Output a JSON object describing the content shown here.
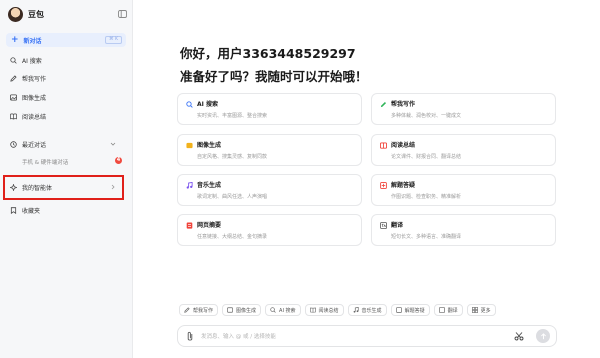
{
  "sidebar": {
    "brand_name": "豆包",
    "new_chat": {
      "label": "新对话",
      "shortcut": "⌘ K"
    },
    "items": [
      {
        "label": "AI 搜索",
        "icon": "search-icon"
      },
      {
        "label": "帮我写作",
        "icon": "pen-icon"
      },
      {
        "label": "图像生成",
        "icon": "image-icon"
      },
      {
        "label": "阅读总结",
        "icon": "book-icon"
      }
    ],
    "recent": {
      "label": "最近对话",
      "icon": "chat-icon"
    },
    "recent_sub": {
      "label": "手机 & 硬件端对话",
      "badge": "4"
    },
    "agents": {
      "label": "我的智能体",
      "icon": "sparkle-icon"
    },
    "favorites": {
      "label": "收藏夹",
      "icon": "bookmark-icon"
    }
  },
  "main": {
    "greeting_line1": "你好，用户3363448529297",
    "greeting_line2": "准备好了吗？我随时可以开始哦！",
    "cards": [
      {
        "title": "AI 搜索",
        "desc": "实时资讯、丰富图源、整合搜索",
        "icon": "search-icon",
        "color": "#3570f5"
      },
      {
        "title": "帮我写作",
        "desc": "多种体裁、润色校对、一键成文",
        "icon": "pen-icon",
        "color": "#2fb55a"
      },
      {
        "title": "图像生成",
        "desc": "自定风格、搜集灵感、复制同款",
        "icon": "image-icon",
        "color": "#f2b21c"
      },
      {
        "title": "阅读总结",
        "desc": "论文课件、财报合同、翻译总结",
        "icon": "book-icon",
        "color": "#f0433a"
      },
      {
        "title": "音乐生成",
        "desc": "歌词定制、曲风任选、人声演唱",
        "icon": "music-icon",
        "color": "#7a52ee"
      },
      {
        "title": "解题答疑",
        "desc": "作图识题、检查职务、精准解析",
        "icon": "calc-icon",
        "color": "#f0433a"
      },
      {
        "title": "网页摘要",
        "desc": "任意链接、大纲总结、金句摘录",
        "icon": "web-icon",
        "color": "#f0433a"
      },
      {
        "title": "翻译",
        "desc": "短句长文、多种语言、准确翻译",
        "icon": "translate-icon",
        "color": "#555555"
      }
    ],
    "chips": [
      {
        "label": "帮我写作",
        "icon": "pen-icon"
      },
      {
        "label": "图像生成",
        "icon": "image-icon"
      },
      {
        "label": "AI 搜索",
        "icon": "search-icon"
      },
      {
        "label": "阅读总结",
        "icon": "book-icon"
      },
      {
        "label": "音乐生成",
        "icon": "music-icon"
      },
      {
        "label": "解题答疑",
        "icon": "calc-icon"
      },
      {
        "label": "翻译",
        "icon": "translate-icon"
      },
      {
        "label": "更多",
        "icon": "grid-icon"
      }
    ],
    "input": {
      "placeholder": "发消息、输入 @ 或 / 选择技能"
    }
  }
}
